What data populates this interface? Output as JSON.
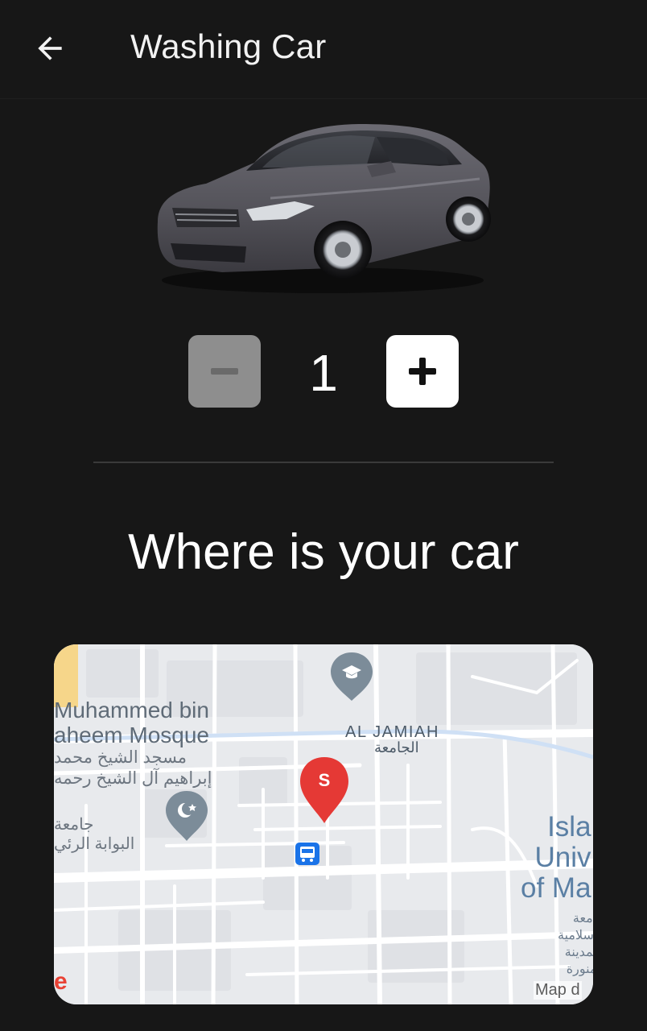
{
  "appbar": {
    "title": "Washing Car",
    "back_icon": "arrow-left-icon"
  },
  "product": {
    "image": "car-image"
  },
  "quantity": {
    "value": "1",
    "minus_icon": "minus-icon",
    "plus_icon": "plus-icon"
  },
  "location": {
    "heading": "Where is your car"
  },
  "map": {
    "labels": {
      "mosque_en": "Muhammed bin\naheem Mosque",
      "mosque_ar": "مسجد الشيخ محمد\nإبراهيم آل الشيخ رحمه",
      "gate_ar": "جامعة\nالبوابة الرئي",
      "jamiah_en": "AL JAMIAH",
      "jamiah_ar": "الجامعة",
      "university_en": "Isla\nUniv\nof Ma",
      "university_ar": "جامعة\nالإسلامية\nبالمدينة\nالمنورة",
      "map_data": "Map d",
      "google_fragment": "e"
    },
    "marker_letter": "S",
    "colors": {
      "pin": "#e53935",
      "poi_pin": "#7c8c99",
      "bus_stop": "#1a73e8",
      "background": "#e8eaed"
    }
  },
  "colors": {
    "background": "#171717",
    "stepper_disabled": "#8e8e8e",
    "stepper_active": "#ffffff"
  }
}
